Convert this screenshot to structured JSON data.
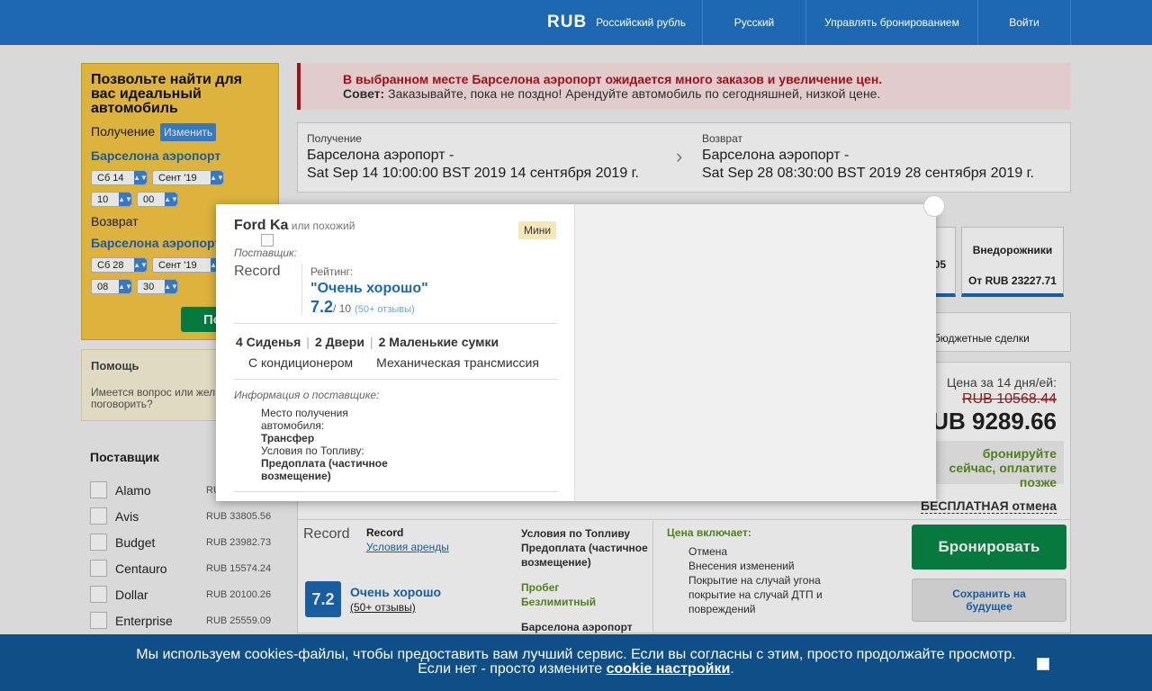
{
  "header": {
    "currency_code": "RUB",
    "currency_name": "Российский рубль",
    "language": "Русский",
    "manage": "Управлять бронированием",
    "login": "Войти"
  },
  "search": {
    "title": "Позвольте найти для вас идеальный автомобиль",
    "pickup_label": "Получение",
    "edit_label": "Изменить",
    "pickup_location": "Барселона аэропорт",
    "pickup_day": "Сб 14",
    "pickup_month": "Сент '19",
    "pickup_hour": "10",
    "pickup_min": "00",
    "return_label": "Возврат",
    "return_location": "Барселона аэропорт",
    "return_day": "Сб 28",
    "return_month": "Сент '19",
    "return_hour": "08",
    "return_min": "30",
    "button": "По"
  },
  "help": {
    "title": "Помощь",
    "text": "Имеется вопрос или жел нами поговорить?"
  },
  "suppliers": {
    "title": "Поставщик",
    "items": [
      {
        "name": "Alamo",
        "price": "RU"
      },
      {
        "name": "Avis",
        "price": "RUB 33805.56"
      },
      {
        "name": "Budget",
        "price": "RUB 23982.73"
      },
      {
        "name": "Centauro",
        "price": "RUB 15574.24"
      },
      {
        "name": "Dollar",
        "price": "RUB 20100.26"
      },
      {
        "name": "Enterprise",
        "price": "RUB 25559.09"
      }
    ]
  },
  "alert": {
    "line1": "В выбранном месте Барселона аэропорт ожидается много заказов и увеличение цен.",
    "tip_label": "Совет:",
    "line2": " Заказывайте, пока не поздно! Арендуйте автомобиль по сегодняшней, низкой цене."
  },
  "trip": {
    "pickup_key": "Получение",
    "pickup_line1": "Барселона аэропорт -",
    "pickup_line2": "Sat Sep 14 10:00:00 BST 2019 14 сентября 2019 г.",
    "return_key": "Возврат",
    "return_line1": "Барселона аэропорт -",
    "return_line2": "Sat Sep 28 08:30:00 BST 2019 28 сентября 2019 г."
  },
  "categories": [
    {
      "name": "",
      "price": "05"
    },
    {
      "name": "Внедорожники",
      "price": "От RUB 23227.71"
    }
  ],
  "deals": {
    "title": "на",
    "subtitle": "мые бюджетные сделки"
  },
  "offer": {
    "price_label": "Цена за 14 дня/ей:",
    "old_price": "RUB 10568.44",
    "new_price": "UB 9289.66",
    "pay_later": "бронируйте сейчас, оплатите позже",
    "free_cancel": "БЕСПЛАТНАЯ отмена",
    "supplier_logo": "Record",
    "supplier": "Record",
    "terms": "Условия аренды",
    "score": "7.2",
    "score_text": "Очень хорошо",
    "reviews": "(50+ отзывы)",
    "fuel_title": "Условия по Топливу",
    "fuel_value": "Предоплата (частичное возмещение)",
    "mileage_title": "Пробег",
    "mileage_value": "Безлимитный",
    "location": "Барселона аэропорт",
    "includes_title": "Цена включает:",
    "includes": [
      "Отмена",
      "Внесения изменений",
      "Покрытие на случай угона",
      "покрытие на случай ДТП и повреждений"
    ],
    "book": "Бронировать",
    "save": "Сохранить на будущее"
  },
  "modal": {
    "car": "Ford Ka",
    "similar": " или похожий",
    "badge": "Мини",
    "supplier_label": "Поставщик:",
    "supplier_logo": "Record",
    "rating_label": "Рейтинг:",
    "rating_quote": "\"Очень хорошо\"",
    "rating_value": "7.2",
    "rating_of": "/ 10",
    "rating_count": "(50+ отзывы)",
    "seats": "4 Сиденья",
    "doors": "2 Двери",
    "bags": "2 Маленькие сумки",
    "ac": "С кондиционером",
    "transmission": "Механическая трансмиссия",
    "info_label": "Информация о поставщике:",
    "pickup_place_label": "Место получения автомобиля:",
    "pickup_place": "Трансфер",
    "fuel_label": "Условия по Топливу:",
    "fuel": "Предоплата (частичное возмещение)"
  },
  "cookie": {
    "line1": "Мы используем cookies-файлы, чтобы предоставить вам лучший сервис. Если вы согласны с этим, просто продолжайте просмотр.",
    "line2_prefix": "Если нет - просто измените ",
    "link": "cookie настройки",
    "line2_suffix": "."
  }
}
